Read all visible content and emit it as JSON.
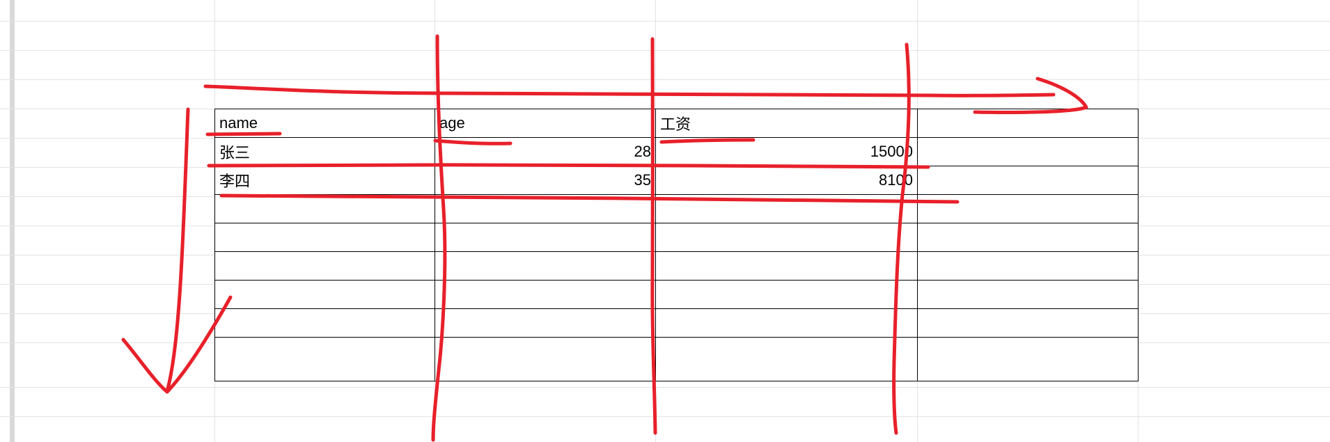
{
  "sheet": {
    "table": {
      "rows": [
        [
          "name",
          "age",
          "工资",
          ""
        ],
        [
          "张三",
          "28",
          "15000",
          ""
        ],
        [
          "李四",
          "35",
          "8100",
          ""
        ],
        [
          "",
          "",
          "",
          ""
        ],
        [
          "",
          "",
          "",
          ""
        ],
        [
          "",
          "",
          "",
          ""
        ],
        [
          "",
          "",
          "",
          ""
        ],
        [
          "",
          "",
          "",
          ""
        ],
        [
          "",
          "",
          "",
          ""
        ]
      ]
    }
  },
  "annotation": {
    "ink_color": "#e8202a",
    "marks": [
      "horizontal-arrow-right",
      "vertical-arrow-down",
      "column-divider-strokes",
      "row-underline-strokes"
    ]
  }
}
